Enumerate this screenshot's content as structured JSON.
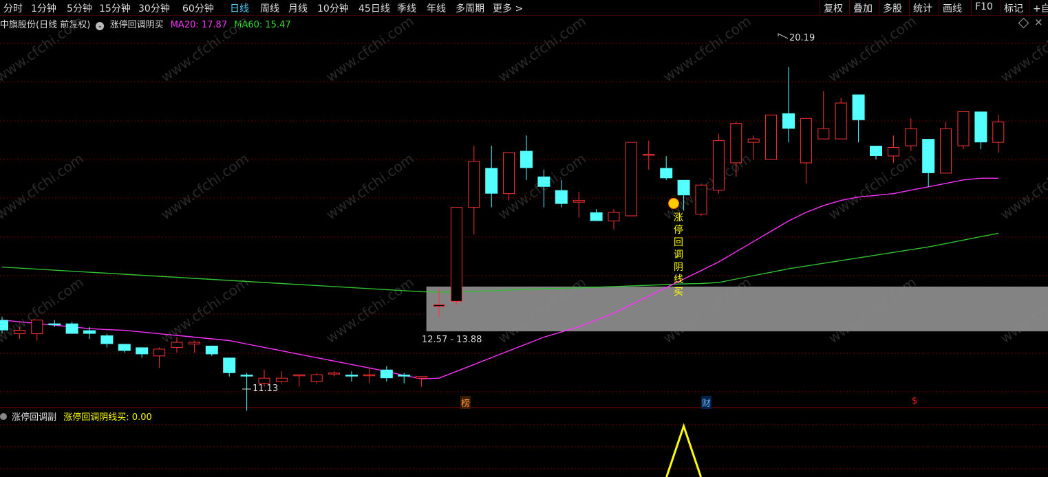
{
  "toolbar": {
    "periods": [
      "分时",
      "1分钟",
      "5分钟",
      "15分钟",
      "30分钟",
      "60分钟",
      "日线",
      "周线",
      "月线",
      "10分钟",
      "45日线",
      "季线",
      "年线",
      "多周期",
      "更多 >"
    ],
    "active_index": 6,
    "right_buttons": [
      "复权",
      "叠加",
      "多股",
      "统计",
      "画线",
      "F10",
      "标记",
      "+自"
    ]
  },
  "info": {
    "stock_title": "中旗股份(日线 前复权)",
    "indicator_name": "涨停回调阴买",
    "ma20_label": "MA20: 17.87",
    "ma60_label": "MA60: 15.47"
  },
  "annotations": {
    "high_label": "20.19",
    "low_label": "11.13",
    "range_label": "12.57 - 13.88",
    "signal_text": [
      "涨",
      "停",
      "回",
      "调",
      "阴",
      "线",
      "买"
    ],
    "marker_bang": "榜",
    "marker_cai": "财",
    "marker_dollar": "$"
  },
  "sub": {
    "indicator_name": "涨停回调副",
    "value_label": "涨停回调阴线买: 0.00"
  },
  "watermark": "www.cfchi.com",
  "colors": {
    "up": "#ff3232",
    "down": "#54ffff",
    "ma20": "#ff32ff",
    "ma60": "#30c030",
    "signal": "#ffff00",
    "grid": "#7a0000",
    "band": "#8a8a8a"
  },
  "chart_data": {
    "type": "candlestick",
    "y_range": [
      10.5,
      21.3
    ],
    "candles": [
      {
        "o": 12.9,
        "h": 13.0,
        "l": 12.5,
        "c": 12.6
      },
      {
        "o": 12.5,
        "h": 12.7,
        "l": 12.35,
        "c": 12.6
      },
      {
        "o": 12.5,
        "h": 12.9,
        "l": 12.3,
        "c": 12.9
      },
      {
        "o": 12.8,
        "h": 12.9,
        "l": 12.7,
        "c": 12.75
      },
      {
        "o": 12.8,
        "h": 12.85,
        "l": 12.5,
        "c": 12.5
      },
      {
        "o": 12.6,
        "h": 12.7,
        "l": 12.35,
        "c": 12.5
      },
      {
        "o": 12.45,
        "h": 12.5,
        "l": 12.1,
        "c": 12.2
      },
      {
        "o": 12.2,
        "h": 12.2,
        "l": 11.95,
        "c": 12.0
      },
      {
        "o": 12.1,
        "h": 12.1,
        "l": 11.8,
        "c": 11.9
      },
      {
        "o": 11.85,
        "h": 12.1,
        "l": 11.5,
        "c": 12.05
      },
      {
        "o": 12.1,
        "h": 12.4,
        "l": 11.95,
        "c": 12.25
      },
      {
        "o": 12.2,
        "h": 12.3,
        "l": 11.95,
        "c": 12.25
      },
      {
        "o": 12.15,
        "h": 12.15,
        "l": 11.85,
        "c": 11.9
      },
      {
        "o": 11.8,
        "h": 11.8,
        "l": 11.25,
        "c": 11.35
      },
      {
        "o": 11.3,
        "h": 11.35,
        "l": 10.25,
        "c": 11.25
      },
      {
        "o": 11.05,
        "h": 11.45,
        "l": 10.95,
        "c": 11.2
      },
      {
        "o": 11.1,
        "h": 11.4,
        "l": 11.05,
        "c": 11.2
      },
      {
        "o": 11.3,
        "h": 11.3,
        "l": 10.95,
        "c": 11.3
      },
      {
        "o": 11.1,
        "h": 11.35,
        "l": 11.05,
        "c": 11.3
      },
      {
        "o": 11.35,
        "h": 11.4,
        "l": 11.25,
        "c": 11.35
      },
      {
        "o": 11.3,
        "h": 11.4,
        "l": 11.1,
        "c": 11.25
      },
      {
        "o": 11.3,
        "h": 11.5,
        "l": 11.05,
        "c": 11.3
      },
      {
        "o": 11.45,
        "h": 11.55,
        "l": 11.1,
        "c": 11.2
      },
      {
        "o": 11.3,
        "h": 11.35,
        "l": 11.05,
        "c": 11.25
      },
      {
        "o": 11.2,
        "h": 11.25,
        "l": 10.95,
        "c": 11.25
      },
      {
        "o": 13.3,
        "h": 13.8,
        "l": 13.0,
        "c": 13.35
      },
      {
        "o": 13.45,
        "h": 16.2,
        "l": 13.35,
        "c": 16.2
      },
      {
        "o": 16.2,
        "h": 18.0,
        "l": 15.4,
        "c": 17.55
      },
      {
        "o": 17.35,
        "h": 18.0,
        "l": 16.2,
        "c": 16.6
      },
      {
        "o": 16.6,
        "h": 17.8,
        "l": 16.4,
        "c": 17.8
      },
      {
        "o": 17.85,
        "h": 18.3,
        "l": 17.0,
        "c": 17.35
      },
      {
        "o": 17.1,
        "h": 17.3,
        "l": 16.2,
        "c": 16.8
      },
      {
        "o": 16.7,
        "h": 17.0,
        "l": 16.2,
        "c": 16.3
      },
      {
        "o": 16.35,
        "h": 16.65,
        "l": 15.9,
        "c": 16.4
      },
      {
        "o": 16.05,
        "h": 16.15,
        "l": 15.8,
        "c": 15.8
      },
      {
        "o": 15.8,
        "h": 16.15,
        "l": 15.55,
        "c": 16.05
      },
      {
        "o": 15.95,
        "h": 18.1,
        "l": 15.95,
        "c": 18.1
      },
      {
        "o": 17.75,
        "h": 18.15,
        "l": 17.3,
        "c": 17.75
      },
      {
        "o": 17.35,
        "h": 17.7,
        "l": 17.0,
        "c": 17.05
      },
      {
        "o": 17.0,
        "h": 17.0,
        "l": 16.1,
        "c": 16.55
      },
      {
        "o": 16.0,
        "h": 16.85,
        "l": 15.95,
        "c": 16.85
      },
      {
        "o": 16.7,
        "h": 18.35,
        "l": 16.6,
        "c": 18.15
      },
      {
        "o": 17.5,
        "h": 18.7,
        "l": 17.1,
        "c": 18.65
      },
      {
        "o": 18.1,
        "h": 18.3,
        "l": 17.6,
        "c": 18.2
      },
      {
        "o": 17.6,
        "h": 18.9,
        "l": 17.6,
        "c": 18.9
      },
      {
        "o": 18.95,
        "h": 20.3,
        "l": 18.1,
        "c": 18.5
      },
      {
        "o": 17.5,
        "h": 18.8,
        "l": 16.9,
        "c": 18.8
      },
      {
        "o": 18.2,
        "h": 19.6,
        "l": 18.2,
        "c": 18.5
      },
      {
        "o": 18.2,
        "h": 19.4,
        "l": 18.2,
        "c": 19.25
      },
      {
        "o": 19.5,
        "h": 19.5,
        "l": 18.1,
        "c": 18.75
      },
      {
        "o": 18.0,
        "h": 18.0,
        "l": 17.6,
        "c": 17.7
      },
      {
        "o": 17.7,
        "h": 18.3,
        "l": 17.5,
        "c": 17.95
      },
      {
        "o": 18.0,
        "h": 18.8,
        "l": 17.85,
        "c": 18.5
      },
      {
        "o": 18.2,
        "h": 18.2,
        "l": 16.8,
        "c": 17.2
      },
      {
        "o": 17.2,
        "h": 18.7,
        "l": 17.2,
        "c": 18.5
      },
      {
        "o": 18.0,
        "h": 19.0,
        "l": 17.9,
        "c": 19.0
      },
      {
        "o": 19.0,
        "h": 19.0,
        "l": 17.9,
        "c": 18.1
      },
      {
        "o": 18.1,
        "h": 18.9,
        "l": 17.8,
        "c": 18.7
      }
    ],
    "ma20": [
      12.9,
      12.85,
      12.8,
      12.75,
      12.7,
      12.65,
      12.62,
      12.6,
      12.55,
      12.5,
      12.45,
      12.4,
      12.35,
      12.3,
      12.2,
      12.1,
      12.0,
      11.9,
      11.8,
      11.7,
      11.6,
      11.5,
      11.4,
      11.28,
      11.18,
      11.2,
      11.4,
      11.6,
      11.8,
      12.0,
      12.2,
      12.4,
      12.55,
      12.7,
      12.9,
      13.1,
      13.35,
      13.6,
      13.85,
      14.1,
      14.35,
      14.6,
      14.9,
      15.2,
      15.5,
      15.8,
      16.05,
      16.25,
      16.4,
      16.5,
      16.55,
      16.6,
      16.7,
      16.8,
      16.9,
      17.0,
      17.05,
      17.05
    ],
    "ma60": [
      14.45,
      14.42,
      14.39,
      14.36,
      14.33,
      14.3,
      14.27,
      14.24,
      14.21,
      14.18,
      14.15,
      14.12,
      14.09,
      14.06,
      14.03,
      14.0,
      13.97,
      13.94,
      13.91,
      13.88,
      13.85,
      13.82,
      13.79,
      13.76,
      13.73,
      13.72,
      13.72,
      13.74,
      13.76,
      13.78,
      13.8,
      13.82,
      13.83,
      13.84,
      13.86,
      13.88,
      13.9,
      13.92,
      13.94,
      13.96,
      13.97,
      14.0,
      14.1,
      14.2,
      14.3,
      14.4,
      14.48,
      14.56,
      14.64,
      14.72,
      14.8,
      14.88,
      14.96,
      15.04,
      15.14,
      15.24,
      15.34,
      15.44
    ],
    "signal_index": 39,
    "band": {
      "low": 12.57,
      "high": 13.88
    },
    "high": 20.19,
    "low": 11.13
  }
}
